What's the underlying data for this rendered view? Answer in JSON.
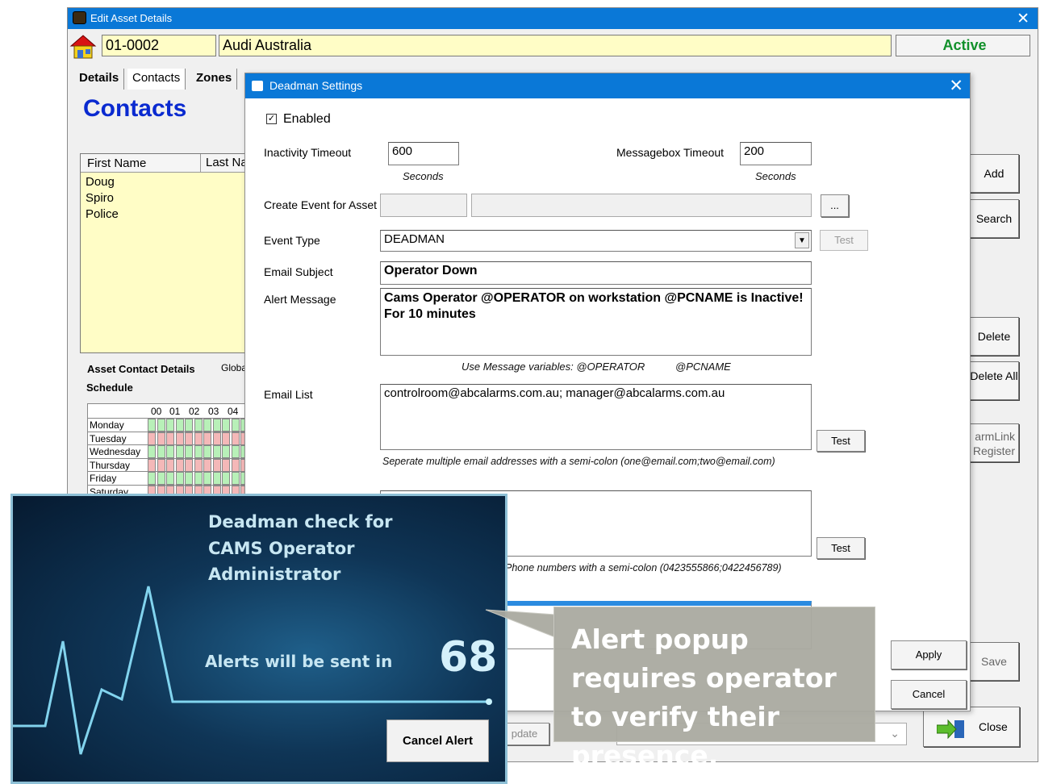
{
  "asset_window": {
    "title": "Edit Asset Details",
    "account_number": "01-0002",
    "account_name": "Audi Australia",
    "status": "Active",
    "tabs": [
      "Details",
      "Contacts",
      "Zones"
    ],
    "section_title": "Contacts",
    "contacts_columns": [
      "First Name",
      "Last Na"
    ],
    "contacts": [
      "Doug",
      "Spiro",
      "Police"
    ],
    "contact_details_label": "Asset Contact Details",
    "global_label": "Globa",
    "schedule_label": "Schedule",
    "hour_headers": [
      "00",
      "01",
      "02",
      "03",
      "04"
    ],
    "days": [
      "Monday",
      "Tuesday",
      "Wednesday",
      "Thursday",
      "Friday",
      "Saturday"
    ],
    "right_buttons": {
      "add": "Add",
      "search": "Search",
      "delete": "Delete",
      "delete_all": "Delete All",
      "alarmlink": "armLink Register",
      "save": "Save",
      "close": "Close",
      "update": "pdate"
    }
  },
  "deadman": {
    "title": "Deadman Settings",
    "enabled_label": "Enabled",
    "enabled": true,
    "inactivity_label": "Inactivity Timeout",
    "inactivity_value": "600",
    "seconds_label": "Seconds",
    "messagebox_label": "Messagebox Timeout",
    "messagebox_value": "200",
    "create_event_label": "Create Event for Asset",
    "browse_label": "...",
    "event_type_label": "Event Type",
    "event_type_value": "DEADMAN",
    "test_label": "Test",
    "email_subject_label": "Email Subject",
    "email_subject_value": "Operator Down",
    "alert_message_label": "Alert Message",
    "alert_message_line1": "Cams Operator @OPERATOR on workstation @PCNAME is Inactive!",
    "alert_message_line2": "For 10 minutes",
    "variables_hint": "Use Message variables:  @OPERATOR",
    "variables_hint2": "@PCNAME",
    "email_list_label": "Email List",
    "email_list_value": "controlroom@abcalarms.com.au; manager@abcalarms.com.au",
    "email_hint": "Seperate multiple email addresses with a semi-colon (one@email.com;two@email.com)",
    "sms_hint": "Phone numbers with a semi-colon (0423555866;0422456789)",
    "apply_label": "Apply",
    "cancel_label": "Cancel"
  },
  "popup": {
    "line1": "Deadman check for",
    "line2": "CAMS Operator",
    "line3": "Administrator",
    "alerts_label": "Alerts will be sent in",
    "countdown": "68",
    "cancel_button": "Cancel Alert"
  },
  "callout": {
    "text": "Alert popup requires operator to verify their presence."
  },
  "colors": {
    "titlebar": "#0a78d7",
    "field_yellow": "#fffdc6",
    "status_green": "#11902a",
    "contacts_blue": "#0a2ad0"
  }
}
